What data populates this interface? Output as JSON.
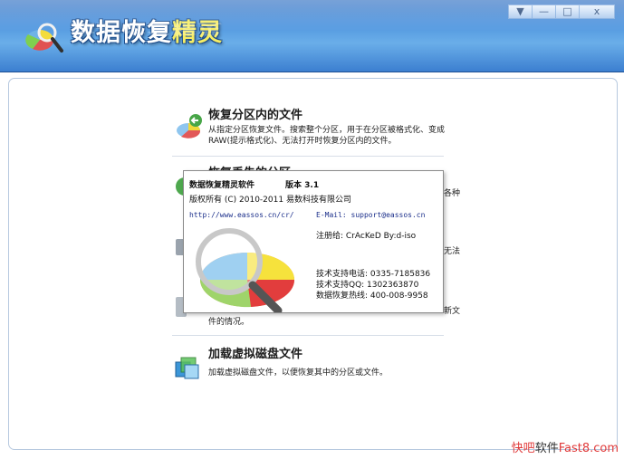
{
  "window": {
    "title_main": "数据恢复",
    "title_accent": "精灵",
    "controls": {
      "menu": "▼",
      "minimize": "—",
      "maximize": "□",
      "close": "x"
    }
  },
  "menu_items": [
    {
      "title": "恢复分区内的文件",
      "desc": "从指定分区恢复文件。搜索整个分区，用于在分区被格式化、变成RAW(提示格式化)、无法打开时恢复分区内的文件。",
      "icon": "partition-files-icon"
    },
    {
      "title": "恢复丢失的分区",
      "desc": "",
      "icon": "lost-partition-icon"
    },
    {
      "title": "加载虚拟磁盘文件",
      "desc": "加载虚拟磁盘文件，以便恢复其中的分区或文件。",
      "icon": "virtual-disk-icon"
    }
  ],
  "fragments": {
    "right_1": "各种",
    "right_2": "无法",
    "right_3": "新文",
    "bottom_left": "件的情况。"
  },
  "about": {
    "product": "数据恢复精灵软件",
    "version": "版本 3.1",
    "copyright": "版权所有 (C) 2010-2011 易数科技有限公司",
    "website": "http://www.eassos.cn/cr/",
    "email": "E-Mail: support@eassos.cn",
    "registered": "注册给:  CrAcKeD By:d-iso",
    "phone": "技术支持电话: 0335-7185836",
    "qq": "技术支持QQ: 1302363870",
    "hotline": "数据恢复热线: 400-008-9958"
  },
  "watermark": {
    "red": "快吧",
    "dark": "软件",
    "tail": "Fast8.com"
  }
}
